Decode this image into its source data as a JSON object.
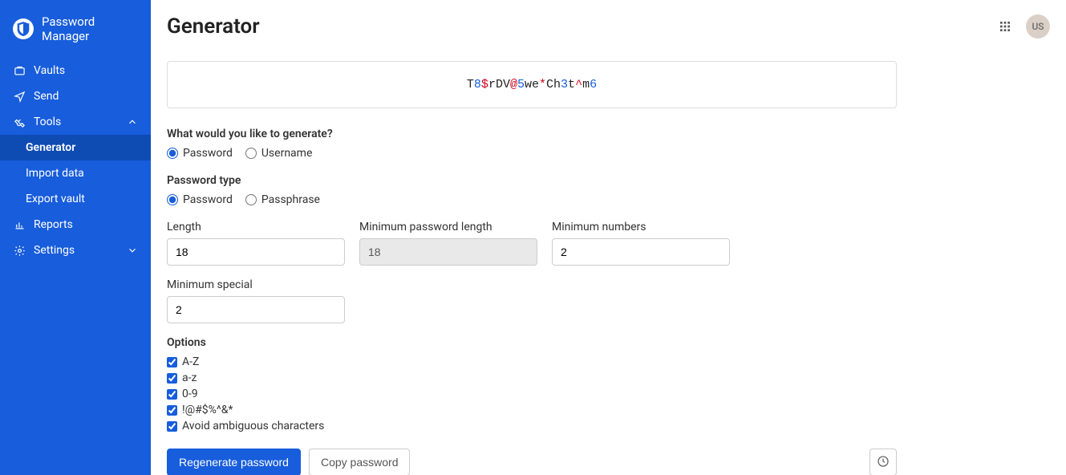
{
  "brand": {
    "name": "Password Manager"
  },
  "sidebar": {
    "items": [
      {
        "label": "Vaults",
        "icon": "vault-icon"
      },
      {
        "label": "Send",
        "icon": "send-icon"
      },
      {
        "label": "Tools",
        "icon": "tools-icon",
        "expanded": true
      },
      {
        "label": "Reports",
        "icon": "reports-icon"
      },
      {
        "label": "Settings",
        "icon": "settings-icon",
        "collapsible": true
      }
    ],
    "tools_sub": [
      {
        "label": "Generator",
        "active": true
      },
      {
        "label": "Import data"
      },
      {
        "label": "Export vault"
      }
    ]
  },
  "header": {
    "title": "Generator",
    "avatar_initials": "US"
  },
  "generator": {
    "output_segments": [
      {
        "t": "T",
        "c": "black"
      },
      {
        "t": "8",
        "c": "blue"
      },
      {
        "t": "$",
        "c": "red"
      },
      {
        "t": "rDV",
        "c": "black"
      },
      {
        "t": "@",
        "c": "red"
      },
      {
        "t": "5",
        "c": "blue"
      },
      {
        "t": "we",
        "c": "black"
      },
      {
        "t": "*",
        "c": "red"
      },
      {
        "t": "Ch",
        "c": "black"
      },
      {
        "t": "3",
        "c": "blue"
      },
      {
        "t": "t",
        "c": "black"
      },
      {
        "t": "^",
        "c": "red"
      },
      {
        "t": "m",
        "c": "black"
      },
      {
        "t": "6",
        "c": "blue"
      }
    ],
    "generate_what_label": "What would you like to generate?",
    "generate_what": [
      {
        "label": "Password",
        "checked": true
      },
      {
        "label": "Username",
        "checked": false
      }
    ],
    "password_type_label": "Password type",
    "password_type": [
      {
        "label": "Password",
        "checked": true
      },
      {
        "label": "Passphrase",
        "checked": false
      }
    ],
    "fields": {
      "length": {
        "label": "Length",
        "value": "18"
      },
      "min_length": {
        "label": "Minimum password length",
        "value": "18",
        "disabled": true
      },
      "min_numbers": {
        "label": "Minimum numbers",
        "value": "2"
      },
      "min_special": {
        "label": "Minimum special",
        "value": "2"
      }
    },
    "options_label": "Options",
    "options": [
      {
        "label": "A-Z",
        "checked": true
      },
      {
        "label": "a-z",
        "checked": true
      },
      {
        "label": "0-9",
        "checked": true
      },
      {
        "label": "!@#$%^&*",
        "checked": true
      },
      {
        "label": "Avoid ambiguous characters",
        "checked": true
      }
    ],
    "actions": {
      "regenerate": "Regenerate password",
      "copy": "Copy password"
    }
  }
}
